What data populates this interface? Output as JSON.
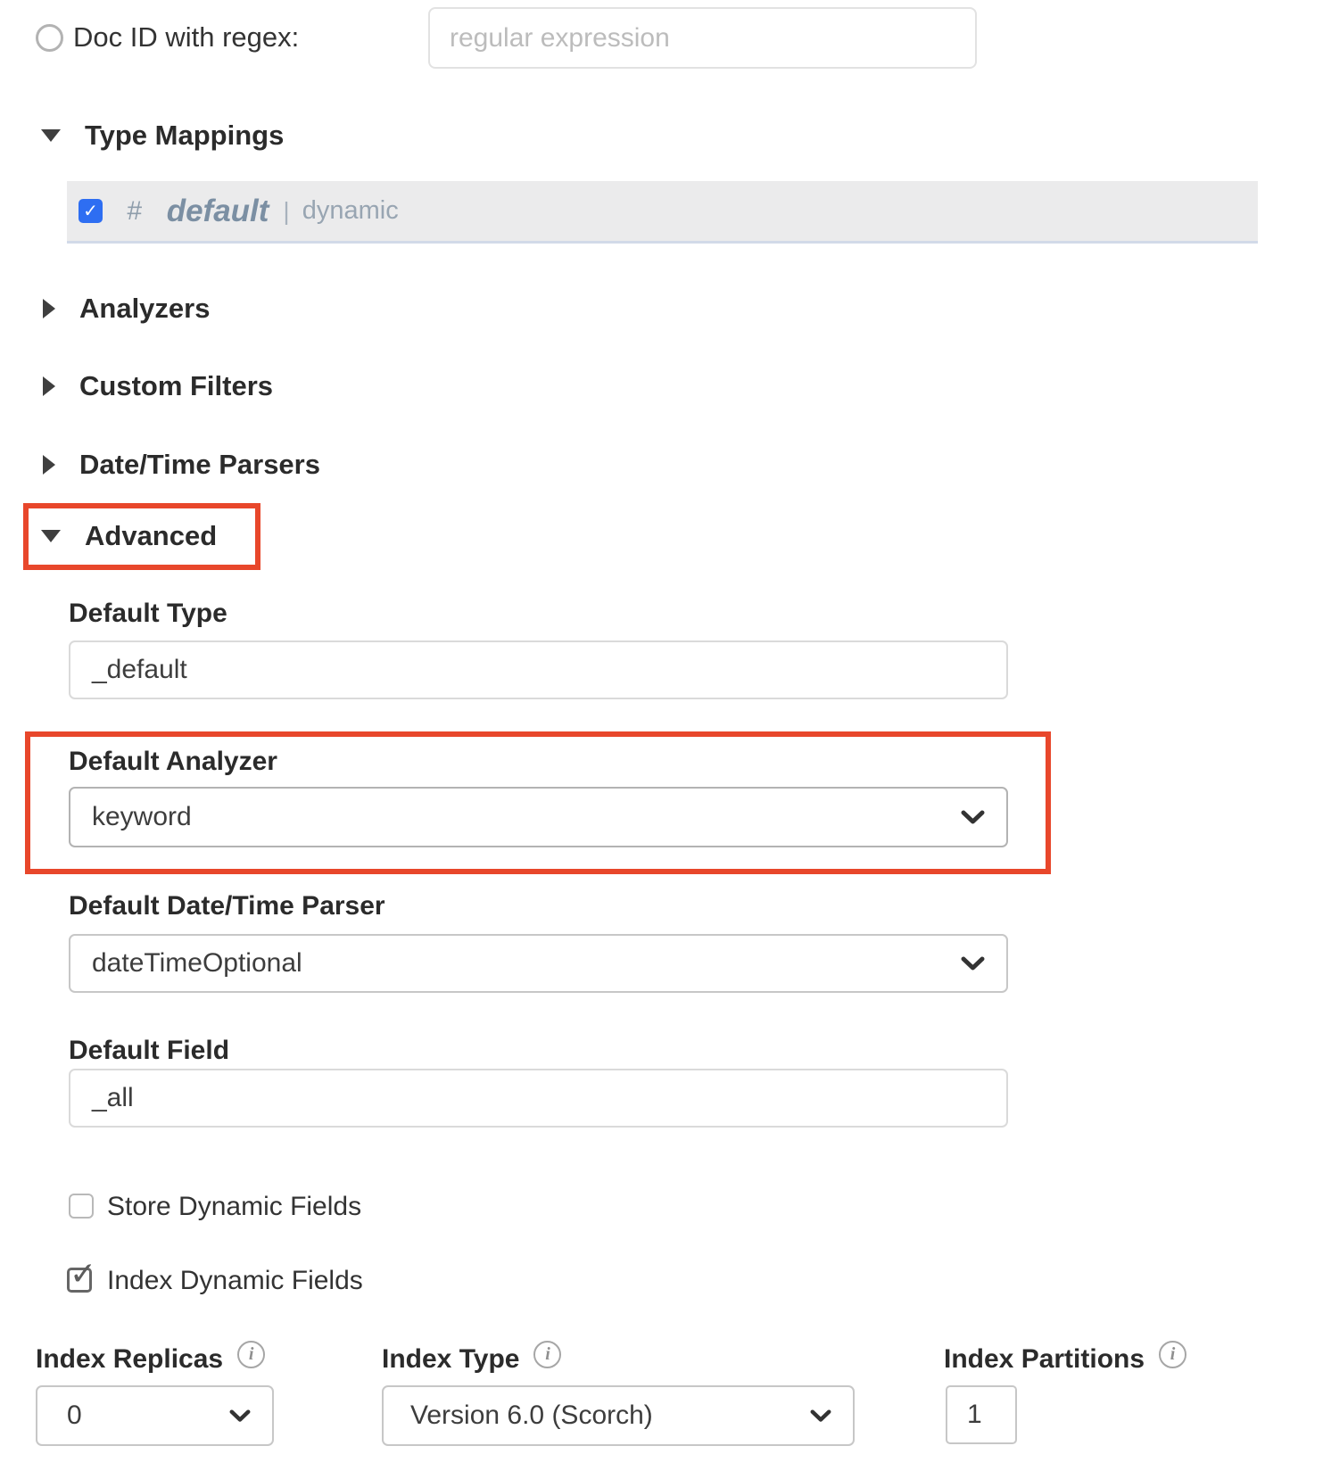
{
  "doc_id_row": {
    "label": "Doc ID with regex:",
    "placeholder": "regular expression",
    "selected": false
  },
  "sections": {
    "type_mappings": {
      "label": "Type Mappings",
      "expanded": true
    },
    "analyzers": {
      "label": "Analyzers",
      "expanded": false
    },
    "custom_filters": {
      "label": "Custom Filters",
      "expanded": false
    },
    "date_time_parsers": {
      "label": "Date/Time Parsers",
      "expanded": false
    },
    "advanced": {
      "label": "Advanced",
      "expanded": true,
      "highlighted": true
    }
  },
  "type_mapping_row": {
    "checked": true,
    "hash": "#",
    "name": "default",
    "separator": "|",
    "mode": "dynamic"
  },
  "advanced_fields": {
    "default_type": {
      "label": "Default Type",
      "value": "_default"
    },
    "default_analyzer": {
      "label": "Default Analyzer",
      "value": "keyword",
      "highlighted": true
    },
    "default_datetime_parser": {
      "label": "Default Date/Time Parser",
      "value": "dateTimeOptional"
    },
    "default_field": {
      "label": "Default Field",
      "value": "_all"
    },
    "store_dynamic_fields": {
      "label": "Store Dynamic Fields",
      "checked": false
    },
    "index_dynamic_fields": {
      "label": "Index Dynamic Fields",
      "checked": true
    }
  },
  "bottom_row": {
    "index_replicas": {
      "label": "Index Replicas",
      "value": "0"
    },
    "index_type": {
      "label": "Index Type",
      "value": "Version 6.0 (Scorch)"
    },
    "index_partitions": {
      "label": "Index Partitions",
      "value": "1"
    }
  },
  "icons": {
    "checkmark": "✓",
    "info": "i"
  },
  "colors": {
    "highlight_red": "#e8472b",
    "checkbox_blue": "#2e6ef2",
    "mapping_row_gray": "#ebebec",
    "mapping_text_blue_gray": "#7b8fa3"
  }
}
